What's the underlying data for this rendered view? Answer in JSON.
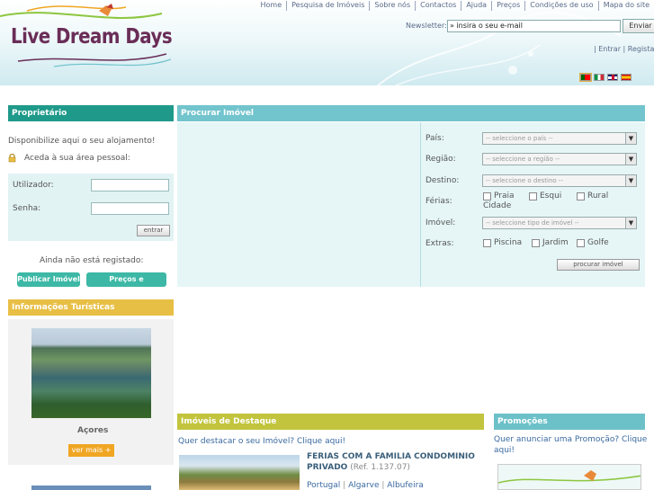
{
  "header": {
    "logo_text": "Live Dream Days",
    "nav": [
      "Home",
      "Pesquisa de Imóveis",
      "Sobre nós",
      "Contactos",
      "Ajuda",
      "Preços",
      "Condições de uso",
      "Mapa do site"
    ],
    "newsletter_label": "Newsletter:",
    "newsletter_value": "» insira o seu e-mail",
    "newsletter_button": "Enviar",
    "auth_links": "| Entrar | Registar",
    "languages": [
      "pt",
      "it",
      "en",
      "es"
    ]
  },
  "proprietario": {
    "title": "Proprietário",
    "line1": "Disponibilize aqui o seu alojamento!",
    "line2": "Aceda à sua área pessoal:",
    "user_label": "Utilizador:",
    "pass_label": "Senha:",
    "enter_button": "entrar",
    "not_registered": "Ainda não está registado:",
    "publish_button": "Publicar Imóvel",
    "prices_button": "Preços e Promoções"
  },
  "search": {
    "title": "Procurar Imóvel",
    "pais_label": "País:",
    "pais_value": "-- seleccione o país --",
    "regiao_label": "Região:",
    "regiao_value": "-- seleccione a região --",
    "destino_label": "Destino:",
    "destino_value": "-- seleccione o destino --",
    "ferias_label": "Férias:",
    "ferias_options": [
      "Praia",
      "Esqui",
      "Rural",
      "Cidade"
    ],
    "imovel_label": "Imóvel:",
    "imovel_value": "-- seleccione tipo de imóvel --",
    "extras_label": "Extras:",
    "extras_options": [
      "Piscina",
      "Jardim",
      "Golfe"
    ],
    "search_button": "procurar imóvel"
  },
  "info": {
    "title": "Informações Turísticas",
    "caption": "Açores",
    "more_button": "ver mais"
  },
  "destaque": {
    "title": "Imóveis de Destaque",
    "cta": "Quer destacar o seu Imóvel? Clique aqui!",
    "listing_title_1": "FERIAS COM A FAMILIA CONDOMINIO",
    "listing_title_2": "PRIVADO",
    "listing_ref": "(Ref. 1.137.07)",
    "listing_location": [
      "Portugal",
      "Algarve",
      "Albufeira"
    ]
  },
  "promocoes": {
    "title": "Promoções",
    "cta_1": "Quer anunciar uma Promoção? Clique",
    "cta_2": "aqui!"
  }
}
